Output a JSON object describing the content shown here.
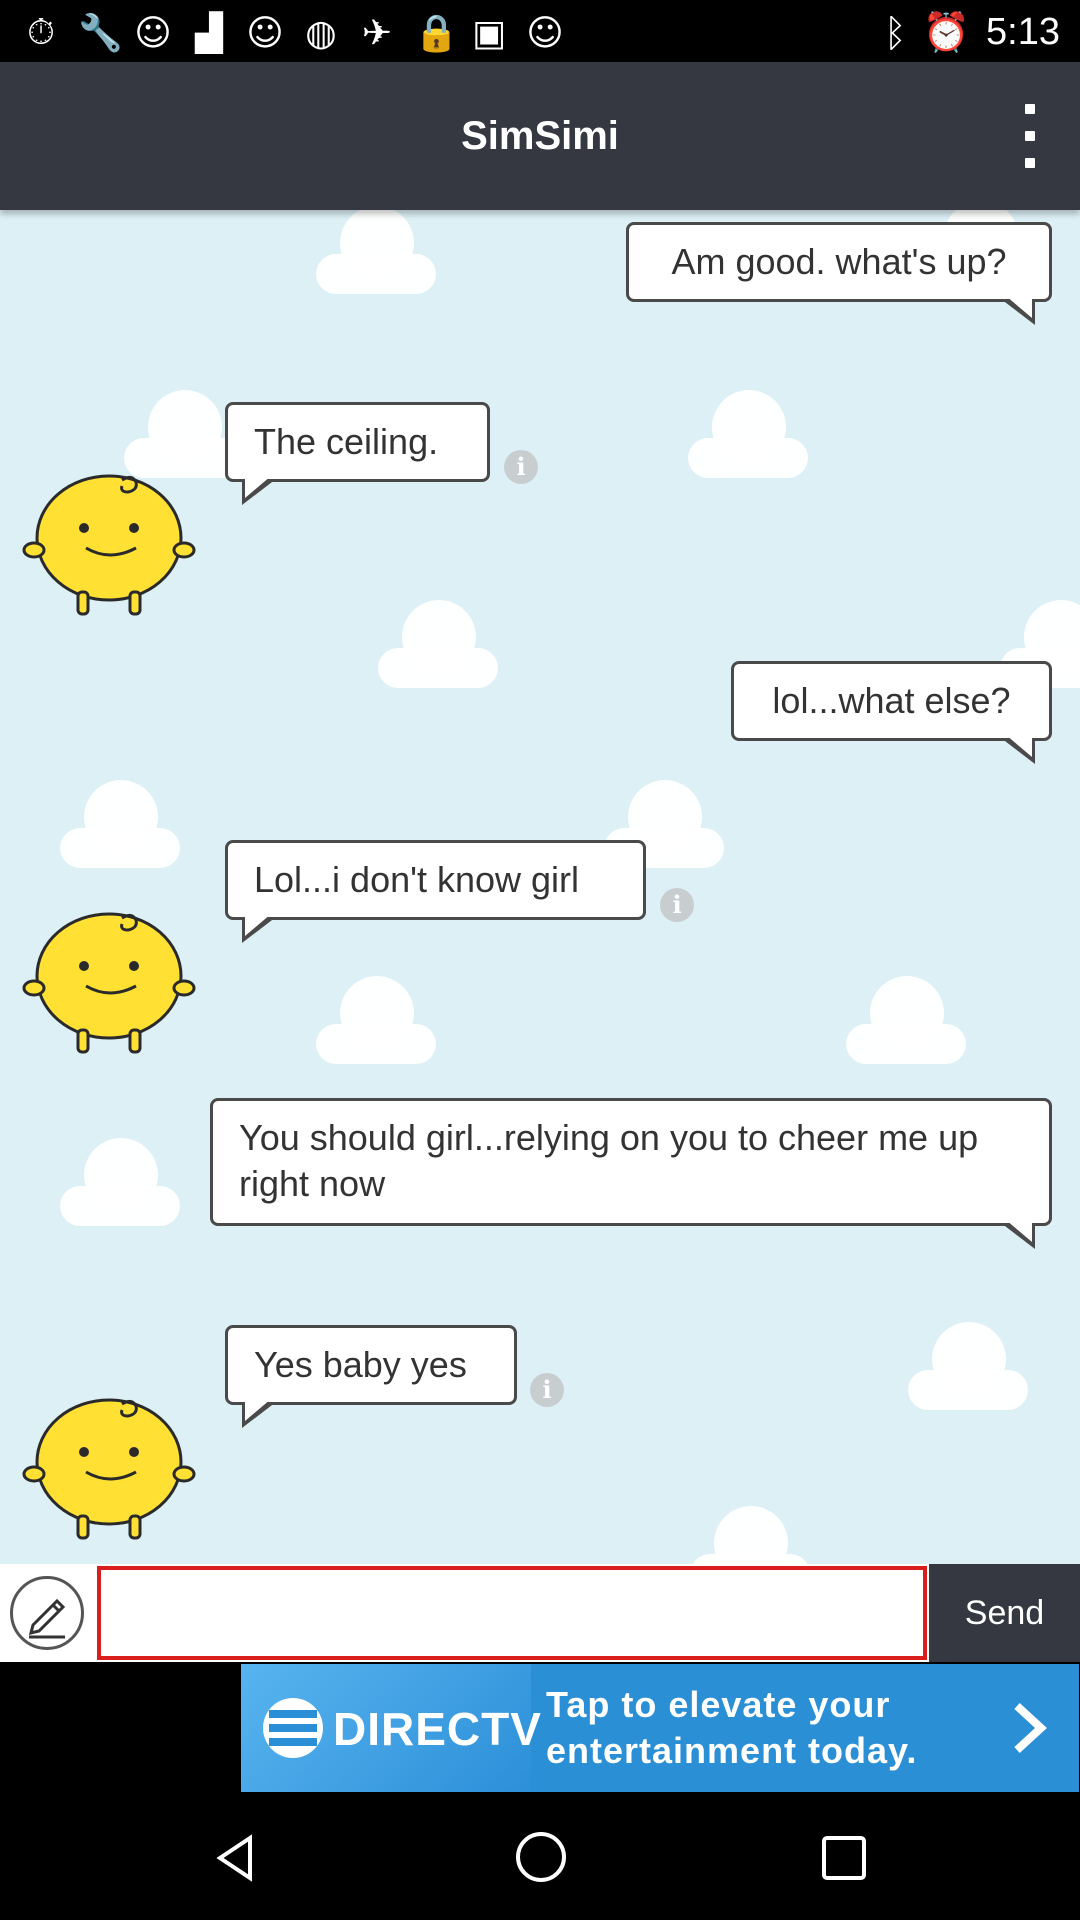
{
  "status_bar": {
    "time": "5:13",
    "left_icons": [
      "timer-icon",
      "wrench-icon",
      "smiley-icon",
      "flipboard-icon",
      "smiley-icon",
      "spinner-icon",
      "satellite-icon",
      "lock-icon",
      "cat-icon",
      "smiley-icon"
    ],
    "right_icons": [
      "bluetooth-icon",
      "alarm-icon"
    ]
  },
  "appbar": {
    "title": "SimSimi",
    "menu_icon": "more-vert-icon"
  },
  "chat": {
    "background_color": "#dcf0f6",
    "messages": [
      {
        "sender": "user",
        "text": "Am good. what's up?"
      },
      {
        "sender": "bot",
        "text": "The ceiling."
      },
      {
        "sender": "user",
        "text": "lol...what else?"
      },
      {
        "sender": "bot",
        "text": "Lol...i don't know girl"
      },
      {
        "sender": "user",
        "text": "You should girl...relying on you to cheer me up right now"
      },
      {
        "sender": "bot",
        "text": "Yes baby yes"
      }
    ],
    "info_glyph": "i"
  },
  "input_bar": {
    "edit_icon": "pencil-icon",
    "message_value": "",
    "send_label": "Send"
  },
  "ad": {
    "brand": "DIRECTV",
    "line1": "Tap to elevate your",
    "line2": "entertainment today.",
    "accent_color": "#2b8fd6"
  },
  "nav_bar": {
    "buttons": [
      "back-icon",
      "home-icon",
      "recents-icon"
    ]
  }
}
